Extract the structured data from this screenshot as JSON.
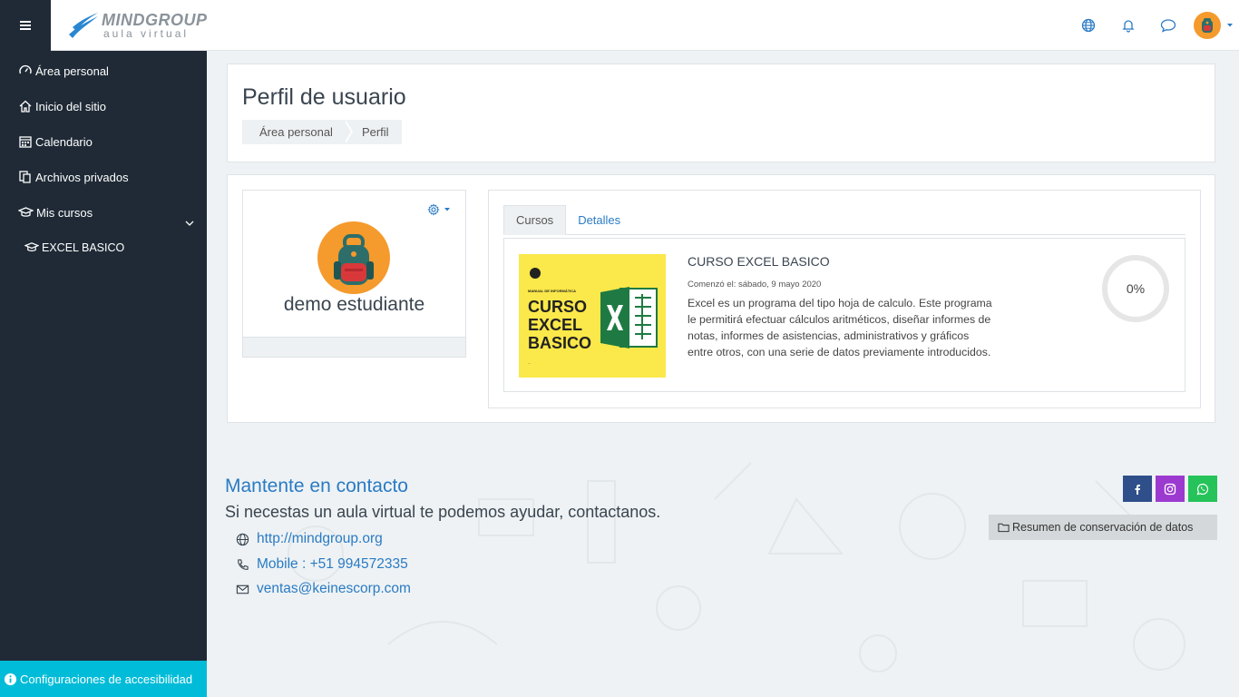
{
  "header": {
    "menu_icon": "hamburger-icon",
    "logo_brand": "MINDGROUP",
    "logo_sub": "aula virtual",
    "icons": [
      "globe-icon",
      "bell-icon",
      "chat-icon",
      "user-avatar"
    ]
  },
  "sidebar": {
    "items": [
      {
        "label": "Área personal",
        "icon": "dashboard-icon"
      },
      {
        "label": "Inicio del sitio",
        "icon": "home-icon"
      },
      {
        "label": "Calendario",
        "icon": "calendar-icon"
      },
      {
        "label": "Archivos privados",
        "icon": "files-icon"
      },
      {
        "label": "Mis cursos",
        "icon": "graduation-cap-icon"
      },
      {
        "label": "EXCEL BASICO",
        "icon": "graduation-cap-icon"
      }
    ],
    "accessibility_label": "Configuraciones de accesibilidad"
  },
  "page": {
    "title": "Perfil de usuario",
    "breadcrumb": [
      "Área personal",
      "Perfil"
    ]
  },
  "profile": {
    "name": "demo estudiante"
  },
  "tabs": [
    "Cursos",
    "Detalles"
  ],
  "course": {
    "image_kicker": "MANUAL DE INFORMÁTICA",
    "image_line1": "CURSO",
    "image_line2": "EXCEL",
    "image_line3": "BASICO",
    "title": "CURSO EXCEL BASICO",
    "started": "Comenzó el: sábado, 9 mayo 2020",
    "description": "Excel es un programa del tipo hoja de calculo. Este programa le permitirá efectuar cálculos aritméticos, diseñar informes de notas, informes de asistencias, administrativos y gráficos entre otros, con una serie de datos previamente introducidos.",
    "progress": "0%",
    "progress_value": 0
  },
  "footer": {
    "title": "Mantente en contacto",
    "subtitle": "Si necestas un aula virtual te podemos ayudar, contactanos.",
    "website": "http://mindgroup.org",
    "mobile": "Mobile : +51 994572335",
    "email": "ventas@keinescorp.com",
    "data_summary": "Resumen de conservación de datos",
    "social_colors": {
      "facebook": "#2e4f8a",
      "instagram": "#9c3ad0",
      "whatsapp": "#25c35a"
    }
  },
  "colors": {
    "sidebar_bg": "#1f2a36",
    "accent": "#2a7bc4",
    "accessibility_bg": "#00bcd8",
    "avatar_orange": "#f59a2c"
  }
}
